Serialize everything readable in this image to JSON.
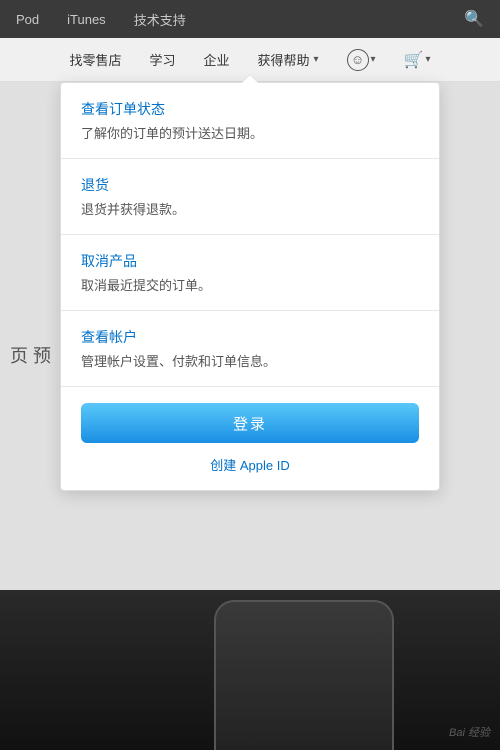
{
  "topNav": {
    "items": [
      "Pod",
      "iTunes",
      "技术支持"
    ],
    "searchLabel": "search"
  },
  "secondNav": {
    "items": [
      {
        "label": "找零售店",
        "hasArrow": false
      },
      {
        "label": "学习",
        "hasArrow": false
      },
      {
        "label": "企业",
        "hasArrow": false
      },
      {
        "label": "获得帮助",
        "hasArrow": true
      }
    ]
  },
  "dropdown": {
    "menuItems": [
      {
        "title": "查看订单状态",
        "desc": "了解你的订单的预计送达日期。"
      },
      {
        "title": "退货",
        "desc": "退货并获得退款。"
      },
      {
        "title": "取消产品",
        "desc": "取消最近提交的订单。"
      },
      {
        "title": "查看帐户",
        "desc": "管理帐户设置、付款和订单信息。"
      }
    ],
    "loginButtonLabel": "登录",
    "createAppleIdPrefix": "创建",
    "createAppleIdText": "Apple ID"
  },
  "pageLabel": "页 预",
  "bottomWatermark": "Bai 经验"
}
